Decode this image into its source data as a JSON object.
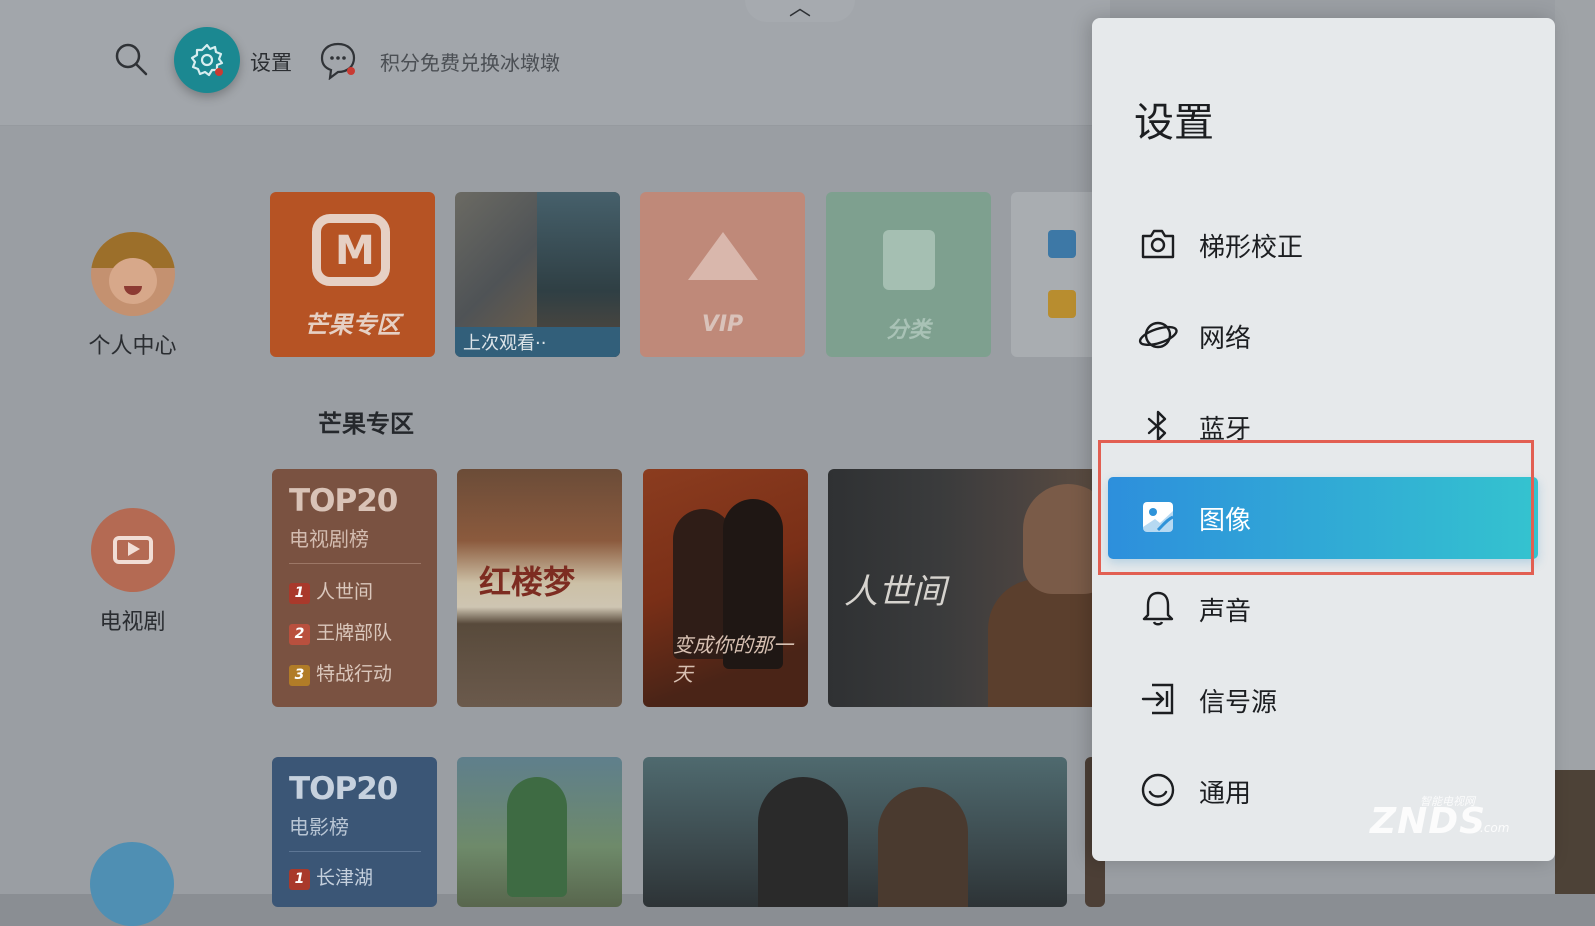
{
  "topbar": {
    "settings_label": "设置",
    "promo_text": "积分免费兑换冰墩墩"
  },
  "sidebar": {
    "items": [
      {
        "label": "个人中心"
      },
      {
        "label": "电视剧"
      }
    ]
  },
  "tiles": {
    "mango_label": "芒果专区",
    "last_watched_label": "上次观看··",
    "vip_label": "VIP",
    "category_label": "分类"
  },
  "section": {
    "title": "芒果专区"
  },
  "rankings": {
    "tv": {
      "title": "TOP20",
      "subtitle": "电视剧榜",
      "items": [
        {
          "rank": "1",
          "name": "人世间"
        },
        {
          "rank": "2",
          "name": "王牌部队"
        },
        {
          "rank": "3",
          "name": "特战行动"
        }
      ]
    },
    "movie": {
      "title": "TOP20",
      "subtitle": "电影榜",
      "items": [
        {
          "rank": "1",
          "name": "长津湖"
        }
      ]
    }
  },
  "posters": {
    "p1_title": "红楼梦",
    "p2_title": "变成你的那一天",
    "p3_title": "人世间"
  },
  "settings_panel": {
    "title": "设置",
    "items": [
      {
        "label": "梯形校正",
        "icon": "camera-icon"
      },
      {
        "label": "网络",
        "icon": "planet-icon"
      },
      {
        "label": "蓝牙",
        "icon": "bluetooth-icon"
      },
      {
        "label": "图像",
        "icon": "image-icon",
        "selected": true
      },
      {
        "label": "声音",
        "icon": "bell-icon"
      },
      {
        "label": "信号源",
        "icon": "input-source-icon"
      },
      {
        "label": "通用",
        "icon": "general-icon"
      }
    ]
  },
  "watermark": {
    "main": "ZNDS",
    "sub": "智能电视网",
    "com": ".com"
  },
  "colors": {
    "selected_gradient_start": "#2d8fdc",
    "selected_gradient_end": "#34c3cf",
    "focus_outline": "#e25f52",
    "gear_button": "#1b8891"
  }
}
